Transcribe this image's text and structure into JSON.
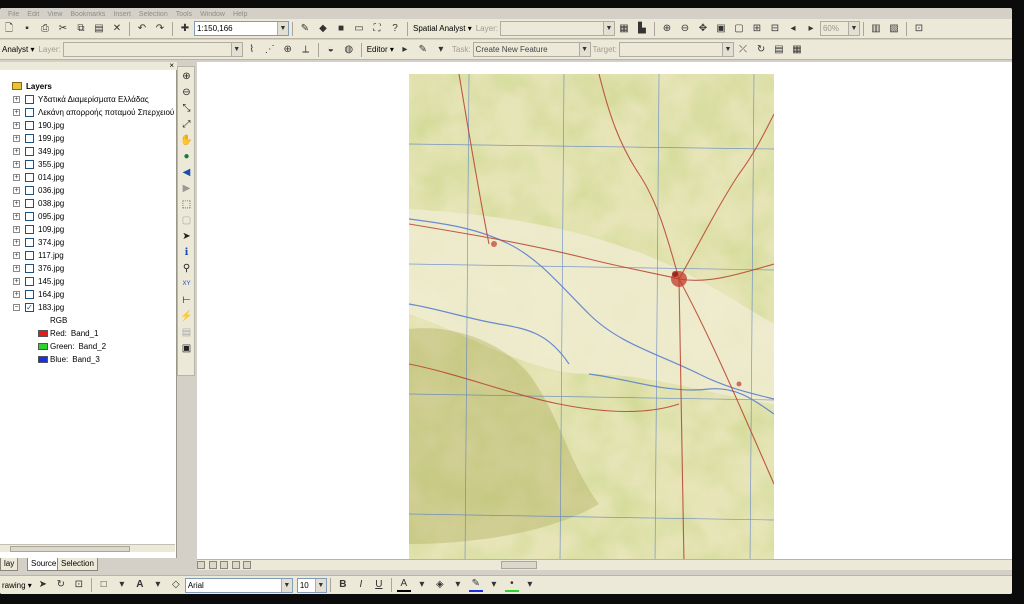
{
  "menubar": [
    "File",
    "Edit",
    "View",
    "Bookmarks",
    "Insert",
    "Selection",
    "Tools",
    "Window",
    "Help"
  ],
  "standard_toolbar": {
    "scale_value": "1:150,166",
    "spatial_analyst_label": "Spatial Analyst",
    "layer_label": "Layer:",
    "zoom_percent": "60%"
  },
  "second_toolbar": {
    "analyst_label": "Analyst",
    "layer_label": "Layer:",
    "editor_label": "Editor",
    "task_label": "Task:",
    "task_value": "Create New Feature",
    "target_label": "Target:"
  },
  "toc": {
    "title": "Layers",
    "close_glyph": "×",
    "layers": [
      {
        "name": "Υδατικά Διαμερίσματα Ελλάδας",
        "checked": false
      },
      {
        "name": "Λεκάνη απορροής ποταμού Σπερχειού",
        "checked": false
      },
      {
        "name": "190.jpg",
        "checked": false
      },
      {
        "name": "199.jpg",
        "checked": false
      },
      {
        "name": "349.jpg",
        "checked": false
      },
      {
        "name": "355.jpg",
        "checked": false
      },
      {
        "name": "014.jpg",
        "checked": false
      },
      {
        "name": "036.jpg",
        "checked": false
      },
      {
        "name": "038.jpg",
        "checked": false
      },
      {
        "name": "095.jpg",
        "checked": false
      },
      {
        "name": "109.jpg",
        "checked": false
      },
      {
        "name": "374.jpg",
        "checked": false
      },
      {
        "name": "117.jpg",
        "checked": false
      },
      {
        "name": "376.jpg",
        "checked": false
      },
      {
        "name": "145.jpg",
        "checked": false
      },
      {
        "name": "164.jpg",
        "checked": false
      },
      {
        "name": "183.jpg",
        "checked": true
      }
    ],
    "rgb_label": "RGB",
    "bands": [
      {
        "channel": "Red:",
        "band": "Band_1",
        "color": "#e21b1b"
      },
      {
        "channel": "Green:",
        "band": "Band_2",
        "color": "#2fd12f"
      },
      {
        "channel": "Blue:",
        "band": "Band_3",
        "color": "#1b2fe2"
      }
    ],
    "tabs": [
      "lay",
      "Source",
      "Selection"
    ]
  },
  "drawing_toolbar": {
    "drawing_label": "rawing",
    "font_name": "Arial",
    "font_size": "10",
    "bold": "B",
    "italic": "I",
    "underline": "U",
    "text_color_glyph": "A"
  },
  "colors": {
    "window_bg": "#d4d0c8",
    "toolbar_bg": "#ece9d8",
    "map_base": "#e8e6b8",
    "map_green": "#b9c77a",
    "map_road": "#b8402e",
    "map_water": "#5a7fd0"
  }
}
